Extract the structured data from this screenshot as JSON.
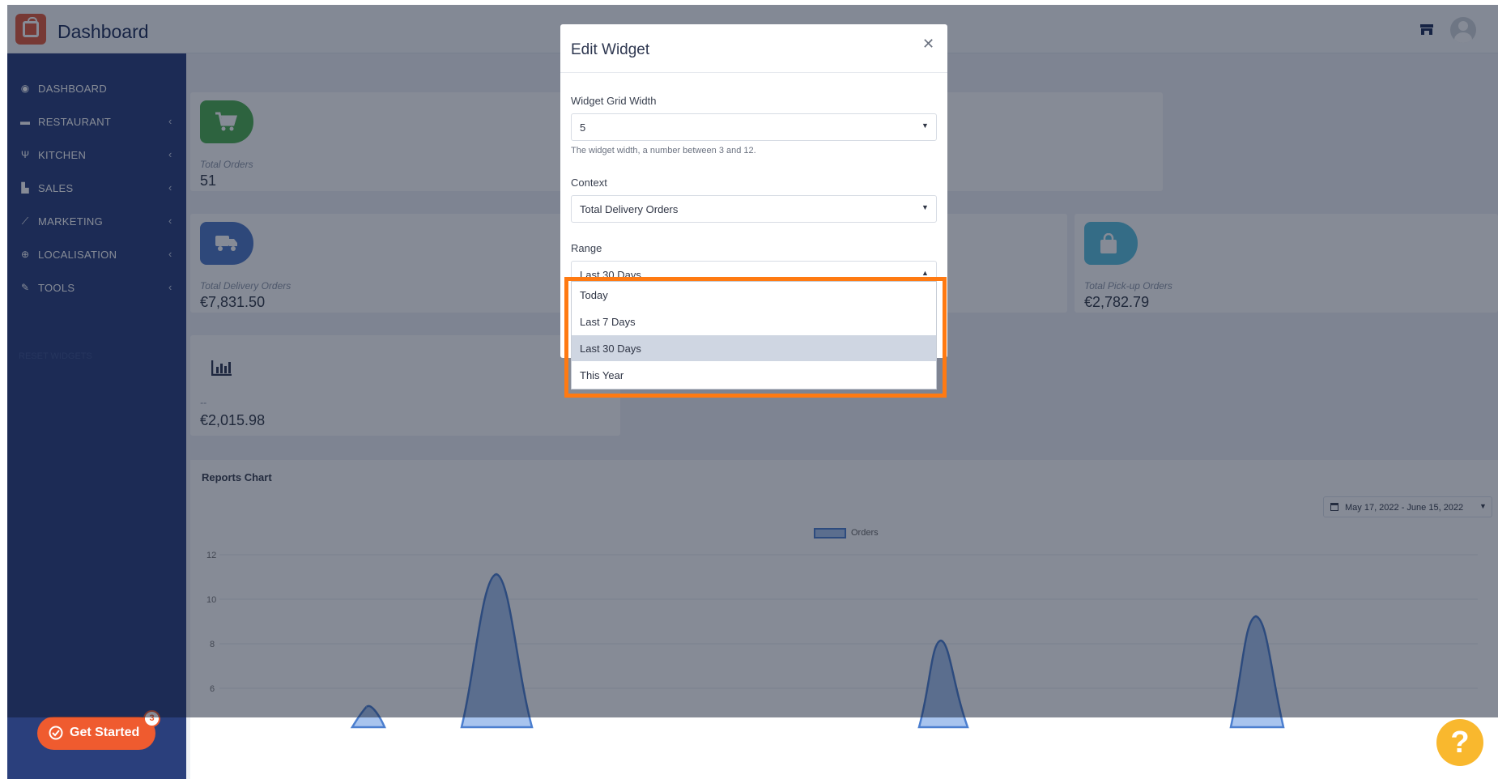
{
  "header": {
    "title": "Dashboard"
  },
  "sidebar": {
    "items": [
      {
        "label": "DASHBOARD",
        "icon": "dashboard-icon",
        "chevron": false
      },
      {
        "label": "RESTAURANT",
        "icon": "store-icon",
        "chevron": true
      },
      {
        "label": "KITCHEN",
        "icon": "utensils-icon",
        "chevron": true
      },
      {
        "label": "SALES",
        "icon": "chart-bar-icon",
        "chevron": true
      },
      {
        "label": "MARKETING",
        "icon": "chart-line-icon",
        "chevron": true
      },
      {
        "label": "LOCALISATION",
        "icon": "globe-icon",
        "chevron": true
      },
      {
        "label": "TOOLS",
        "icon": "wrench-icon",
        "chevron": true
      }
    ],
    "faint": "RESET WIDGETS"
  },
  "cards": {
    "total_orders": {
      "label": "Total Orders",
      "value": "51",
      "color": "#4caf50"
    },
    "delivery": {
      "label": "Total Delivery Orders",
      "value": "€7,831.50",
      "color": "#4e78c6"
    },
    "pickup": {
      "label": "Total Pick-up Orders",
      "value": "€2,782.79",
      "color": "#5bc0de"
    },
    "other": {
      "label": "--",
      "value": "€2,015.98"
    }
  },
  "chart": {
    "title": "Reports Chart",
    "date_range": "May 17, 2022 - June 15, 2022",
    "legend": "Orders",
    "yticks": [
      "12",
      "10",
      "8",
      "6"
    ]
  },
  "chart_data": {
    "type": "area",
    "title": "Reports Chart",
    "xlabel": "",
    "ylabel": "",
    "series": [
      {
        "name": "Orders",
        "peaks": [
          5,
          11,
          8,
          9
        ]
      }
    ],
    "ylim": [
      4,
      12
    ],
    "grid": true,
    "legend_position": "top"
  },
  "modal": {
    "title": "Edit Widget",
    "width_label": "Widget Grid Width",
    "width_value": "5",
    "width_help": "The widget width, a number between 3 and 12.",
    "context_label": "Context",
    "context_value": "Total Delivery Orders",
    "range_label": "Range",
    "range_value": "Last 30 Days",
    "range_options": [
      "Today",
      "Last 7 Days",
      "Last 30 Days",
      "This Year"
    ],
    "selected_option": "Last 30 Days"
  },
  "get_started": {
    "label": "Get Started",
    "count": "3"
  },
  "help": {
    "label": "?"
  },
  "colors": {
    "sidebar": "#2a3f7c",
    "accent": "#ef5b2f",
    "highlight": "#ff7a12",
    "help": "#f9b82e"
  }
}
